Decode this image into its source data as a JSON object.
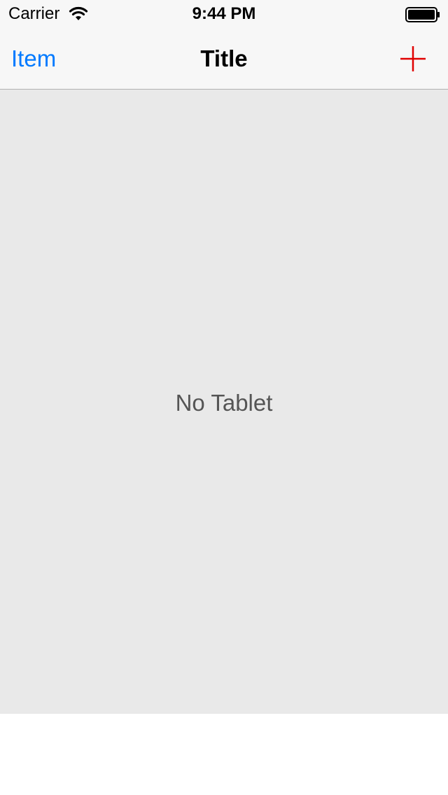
{
  "status_bar": {
    "carrier": "Carrier",
    "time": "9:44 PM",
    "wifi_icon": "wifi-icon",
    "battery_icon": "battery-icon"
  },
  "nav_bar": {
    "left_item": "Item",
    "title": "Title",
    "right_icon": "plus-icon",
    "right_icon_color": "#e00000",
    "left_item_color": "#007aff"
  },
  "content": {
    "empty_message": "No Tablet"
  }
}
